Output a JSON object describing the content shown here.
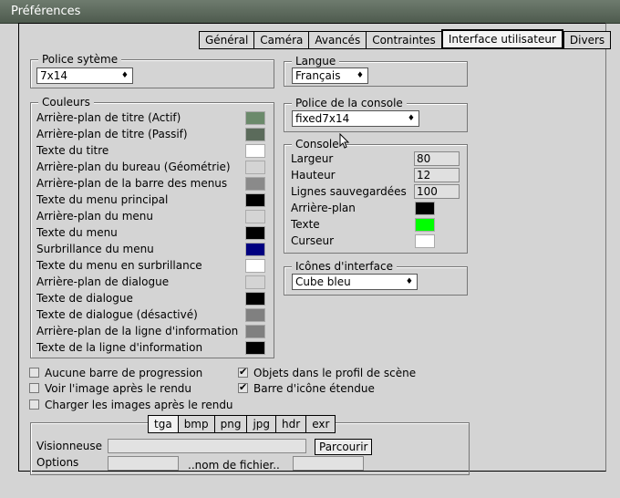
{
  "window": {
    "title": "Préférences"
  },
  "tabs": [
    "Général",
    "Caméra",
    "Avancés",
    "Contraintes",
    "Interface utilisateur",
    "Divers"
  ],
  "active_tab": "Interface utilisateur",
  "font_group": {
    "title": "Police sytème",
    "value": "7x14"
  },
  "language_group": {
    "title": "Langue",
    "value": "Français"
  },
  "console_font_group": {
    "title": "Police de la console",
    "value": "fixed7x14"
  },
  "colors_group": {
    "title": "Couleurs",
    "items": [
      {
        "label": "Arrière-plan de titre (Actif)",
        "color": "#6b8a6b"
      },
      {
        "label": "Arrière-plan de titre (Passif)",
        "color": "#5b6b5b"
      },
      {
        "label": "Texte du titre",
        "color": "#ffffff"
      },
      {
        "label": "Arrière-plan du bureau (Géométrie)",
        "color": "#d4d4d4"
      },
      {
        "label": "Arrière-plan de la barre des menus",
        "color": "#8a8a8a"
      },
      {
        "label": "Texte du menu principal",
        "color": "#000000"
      },
      {
        "label": "Arrière-plan du menu",
        "color": "#d4d4d4"
      },
      {
        "label": "Texte du menu",
        "color": "#000000"
      },
      {
        "label": "Surbrillance du menu",
        "color": "#000080"
      },
      {
        "label": "Texte du menu en surbrillance",
        "color": "#ffffff"
      },
      {
        "label": "Arrière-plan de dialogue",
        "color": "#d4d4d4"
      },
      {
        "label": "Texte de dialogue",
        "color": "#000000"
      },
      {
        "label": "Texte de dialogue (désactivé)",
        "color": "#808080"
      },
      {
        "label": "Arrière-plan de la ligne d'information",
        "color": "#808080"
      },
      {
        "label": "Texte de la ligne d'information",
        "color": "#000000"
      }
    ]
  },
  "console_group": {
    "title": "Console",
    "largeur_label": "Largeur",
    "largeur_value": "80",
    "hauteur_label": "Hauteur",
    "hauteur_value": "12",
    "lignes_label": "Lignes sauvegardées",
    "lignes_value": "100",
    "bg_label": "Arrière-plan",
    "bg_color": "#000000",
    "text_label": "Texte",
    "text_color": "#00ff00",
    "cursor_label": "Curseur",
    "cursor_color": "#ffffff"
  },
  "icons_group": {
    "title": "Icônes d'interface",
    "value": "Cube bleu"
  },
  "checkboxes": {
    "no_progress": "Aucune barre de progression",
    "view_after": "Voir l'image après le rendu",
    "load_after": "Charger les images après le rendu",
    "scene_objects": "Objets dans le profil de scène",
    "icon_bar": "Barre d'icône étendue"
  },
  "image_formats": [
    "tga",
    "bmp",
    "png",
    "jpg",
    "hdr",
    "exr"
  ],
  "active_format": "tga",
  "viewer": {
    "label": "Visionneuse",
    "browse": "Parcourir"
  },
  "options": {
    "label": "Options",
    "filename": "..nom de fichier.."
  }
}
